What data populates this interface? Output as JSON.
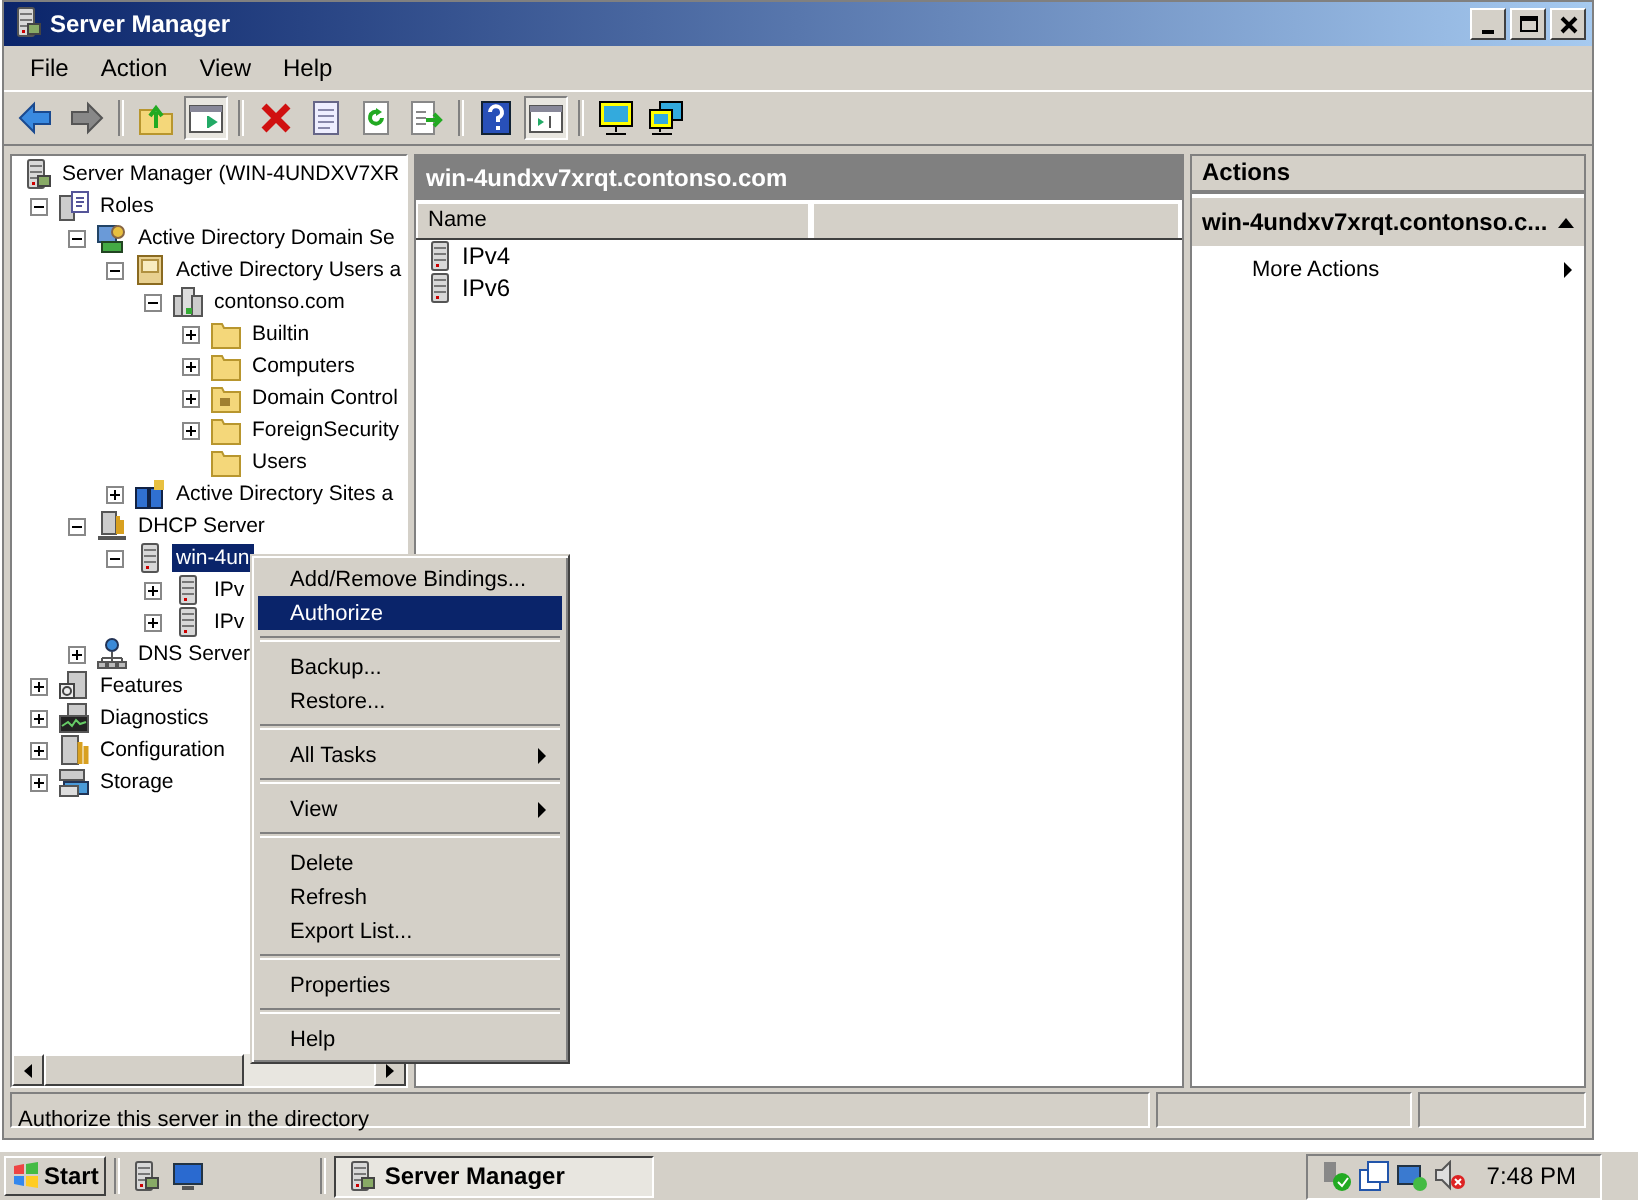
{
  "window": {
    "title": "Server Manager"
  },
  "menu_bar": [
    "File",
    "Action",
    "View",
    "Help"
  ],
  "toolbar": [
    {
      "kind": "back",
      "pressed": false
    },
    {
      "kind": "forward",
      "pressed": false
    },
    {
      "kind": "sep"
    },
    {
      "kind": "up",
      "pressed": false
    },
    {
      "kind": "tree",
      "pressed": true
    },
    {
      "kind": "sep"
    },
    {
      "kind": "delete",
      "pressed": false
    },
    {
      "kind": "properties",
      "pressed": false
    },
    {
      "kind": "refresh",
      "pressed": false
    },
    {
      "kind": "export",
      "pressed": false
    },
    {
      "kind": "sep"
    },
    {
      "kind": "help",
      "pressed": false
    },
    {
      "kind": "actionpane",
      "pressed": true
    },
    {
      "kind": "sep"
    },
    {
      "kind": "monitor",
      "pressed": false
    },
    {
      "kind": "network",
      "pressed": false
    }
  ],
  "tree": {
    "label": "Server Manager (WIN-4UNDXV7XR",
    "kind": "servermgr",
    "selected": false,
    "children": [
      {
        "label": "Roles",
        "kind": "roles",
        "expanded": true,
        "selected": false,
        "children": [
          {
            "label": "Active Directory Domain Se",
            "kind": "adds",
            "expanded": true,
            "selected": false,
            "children": [
              {
                "label": "Active Directory Users a",
                "kind": "book",
                "expanded": true,
                "selected": false,
                "children": [
                  {
                    "label": "contonso.com",
                    "kind": "domain",
                    "expanded": true,
                    "selected": false,
                    "children": [
                      {
                        "label": "Builtin",
                        "kind": "folder",
                        "expanded": false,
                        "selected": false
                      },
                      {
                        "label": "Computers",
                        "kind": "folder",
                        "expanded": false,
                        "selected": false
                      },
                      {
                        "label": "Domain Control",
                        "kind": "ou",
                        "expanded": false,
                        "selected": false
                      },
                      {
                        "label": "ForeignSecurity",
                        "kind": "folder",
                        "expanded": false,
                        "selected": false
                      },
                      {
                        "label": "Users",
                        "kind": "folder",
                        "selected": false
                      }
                    ]
                  }
                ]
              },
              {
                "label": "Active Directory Sites a",
                "kind": "sites",
                "expanded": false,
                "selected": false
              }
            ]
          },
          {
            "label": "DHCP Server",
            "kind": "dhcp",
            "expanded": true,
            "selected": false,
            "children": [
              {
                "label": "win-4un",
                "kind": "db",
                "expanded": true,
                "selected": true,
                "children": [
                  {
                    "label": "IPv",
                    "kind": "db",
                    "expanded": false,
                    "selected": false
                  },
                  {
                    "label": "IPv",
                    "kind": "db",
                    "expanded": false,
                    "selected": false
                  }
                ]
              }
            ]
          },
          {
            "label": "DNS Server",
            "kind": "dns",
            "expanded": false,
            "selected": false
          }
        ]
      },
      {
        "label": "Features",
        "kind": "features",
        "expanded": false,
        "selected": false
      },
      {
        "label": "Diagnostics",
        "kind": "diag",
        "expanded": false,
        "selected": false
      },
      {
        "label": "Configuration",
        "kind": "config",
        "expanded": false,
        "selected": false
      },
      {
        "label": "Storage",
        "kind": "storage",
        "expanded": false,
        "selected": false
      }
    ]
  },
  "center": {
    "title": "win-4undxv7xrqt.contonso.com",
    "columns": [
      "Name"
    ],
    "rows": [
      "IPv4",
      "IPv6"
    ]
  },
  "actions": {
    "title": "Actions",
    "section": "win-4undxv7xrqt.contonso.c...",
    "items": [
      {
        "label": "More Actions",
        "submenu": true
      }
    ]
  },
  "context_menu": [
    {
      "kind": "item",
      "label": "Add/Remove Bindings...",
      "selected": false,
      "submenu": false
    },
    {
      "kind": "item",
      "label": "Authorize",
      "selected": true,
      "submenu": false
    },
    {
      "kind": "separator"
    },
    {
      "kind": "item",
      "label": "Backup...",
      "selected": false,
      "submenu": false
    },
    {
      "kind": "item",
      "label": "Restore...",
      "selected": false,
      "submenu": false
    },
    {
      "kind": "separator"
    },
    {
      "kind": "item",
      "label": "All Tasks",
      "selected": false,
      "submenu": true
    },
    {
      "kind": "separator"
    },
    {
      "kind": "item",
      "label": "View",
      "selected": false,
      "submenu": true
    },
    {
      "kind": "separator"
    },
    {
      "kind": "item",
      "label": "Delete",
      "selected": false,
      "submenu": false
    },
    {
      "kind": "item",
      "label": "Refresh",
      "selected": false,
      "submenu": false
    },
    {
      "kind": "item",
      "label": "Export List...",
      "selected": false,
      "submenu": false
    },
    {
      "kind": "separator"
    },
    {
      "kind": "item",
      "label": "Properties",
      "selected": false,
      "submenu": false
    },
    {
      "kind": "separator"
    },
    {
      "kind": "item",
      "label": "Help",
      "selected": false,
      "submenu": false
    }
  ],
  "status_bar": {
    "text": "Authorize this server in the directory"
  },
  "taskbar": {
    "start": "Start",
    "tasks": [
      {
        "label": "Server Manager",
        "selected": true
      }
    ],
    "clock": "7:48 PM"
  }
}
